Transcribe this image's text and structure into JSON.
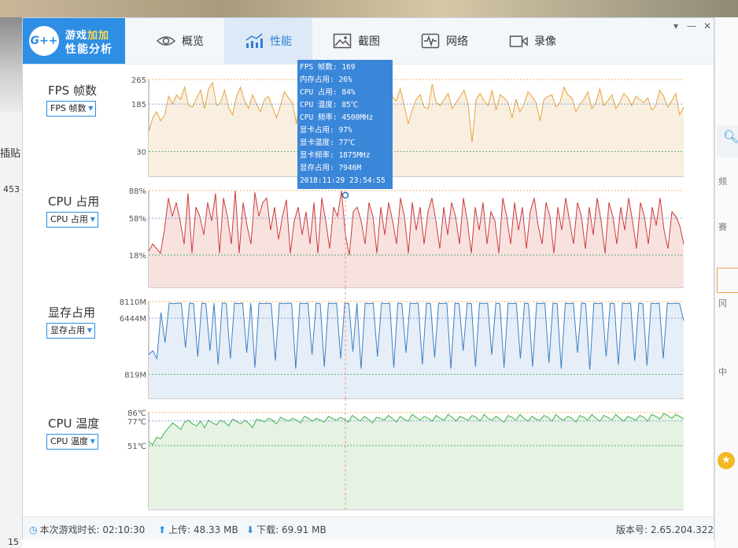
{
  "background": {
    "left_label": "插贴",
    "left_num": "453",
    "left_num2": "15",
    "right_fragments": [
      "频",
      "赛",
      "冈",
      "中"
    ]
  },
  "app": {
    "logo_mark": "G++",
    "logo_title_prefix": "游戏",
    "logo_title_highlight": "加加",
    "logo_subtitle": "性能分析",
    "accent": "#2d8ee4"
  },
  "tabs": [
    {
      "id": "overview",
      "label": "概览",
      "icon": "eye-icon"
    },
    {
      "id": "performance",
      "label": "性能",
      "icon": "performance-chart-icon",
      "active": true
    },
    {
      "id": "screenshot",
      "label": "截图",
      "icon": "image-icon"
    },
    {
      "id": "network",
      "label": "网络",
      "icon": "pulse-icon"
    },
    {
      "id": "record",
      "label": "录像",
      "icon": "video-camera-icon"
    }
  ],
  "window_controls": {
    "menu": "▾",
    "minimize": "—",
    "close": "✕"
  },
  "metrics": [
    {
      "label": "FPS 帧数",
      "select": "FPS 帧数",
      "color": "#e8a33b",
      "fill": "#f8efe0"
    },
    {
      "label": "CPU 占用",
      "select": "CPU 占用",
      "color": "#cc3a3a",
      "fill": "#f8e2e0"
    },
    {
      "label": "显存占用",
      "select": "显存占用",
      "color": "#3b7fc7",
      "fill": "#e6eef7"
    },
    {
      "label": "CPU 温度",
      "select": "CPU 温度",
      "color": "#3cb44b",
      "fill": "#e6f2e3"
    }
  ],
  "tooltip": {
    "lines": [
      "FPS 帧数: 169",
      "内存占用: 26%",
      "CPU 占用: 84%",
      "CPU 温度: 85℃",
      "CPU 频率: 4500MHz",
      "显卡占用: 97%",
      "显卡温度: 77℃",
      "显卡频率: 1875MHz",
      "显存占用: 7946M",
      "2018:11:29 23:54:55"
    ]
  },
  "chart_data": [
    {
      "type": "area",
      "title": "FPS 帧数",
      "ytick_labels": [
        "265",
        "185",
        "30"
      ],
      "y_ticks": [
        265,
        185,
        30
      ],
      "ylim": [
        0,
        265
      ],
      "values": [
        95,
        140,
        160,
        130,
        150,
        210,
        185,
        215,
        200,
        240,
        180,
        175,
        205,
        230,
        170,
        235,
        255,
        180,
        190,
        230,
        175,
        150,
        210,
        240,
        195,
        170,
        215,
        185,
        160,
        200,
        210,
        175,
        140,
        180,
        225,
        205,
        190,
        120,
        215,
        185,
        170,
        205,
        225,
        160,
        130,
        215,
        240,
        190,
        155,
        180,
        200,
        170,
        210,
        185,
        150,
        175,
        225,
        200,
        245,
        185,
        160,
        210,
        195,
        235,
        180,
        120,
        165,
        200,
        215,
        175,
        170,
        250,
        190,
        180,
        200,
        220,
        170,
        190,
        210,
        230,
        185,
        60,
        200,
        220,
        195,
        180,
        230,
        165,
        215,
        205,
        190,
        140,
        200,
        160,
        185,
        225,
        210,
        190,
        130,
        200,
        210,
        215,
        175,
        190,
        240,
        215,
        205,
        160,
        185,
        200,
        225,
        170,
        190,
        235,
        180,
        195,
        215,
        170,
        190,
        220,
        205,
        180,
        210,
        200,
        190,
        205,
        165,
        180,
        230,
        210,
        175,
        195,
        220,
        150,
        175
      ]
    },
    {
      "type": "area",
      "title": "CPU 占用",
      "ytick_labels": [
        "88%",
        "58%",
        "18%"
      ],
      "y_ticks": [
        88,
        58,
        18
      ],
      "ylim": [
        0,
        88
      ],
      "values": [
        22,
        30,
        25,
        20,
        45,
        80,
        60,
        75,
        55,
        30,
        85,
        20,
        70,
        60,
        40,
        75,
        55,
        85,
        20,
        80,
        60,
        30,
        88,
        20,
        75,
        50,
        30,
        86,
        60,
        75,
        80,
        45,
        70,
        35,
        60,
        78,
        20,
        55,
        70,
        40,
        65,
        30,
        75,
        20,
        80,
        55,
        25,
        70,
        60,
        88,
        40,
        18,
        65,
        70,
        55,
        30,
        75,
        60,
        20,
        70,
        40,
        75,
        55,
        30,
        80,
        60,
        20,
        75,
        45,
        70,
        30,
        65,
        80,
        55,
        25,
        70,
        40,
        75,
        60,
        30,
        80,
        55,
        20,
        70,
        45,
        75,
        30,
        65,
        55,
        20,
        80,
        60,
        30,
        75,
        45,
        70,
        25,
        65,
        80,
        50,
        30,
        75,
        60,
        20,
        70,
        45,
        80,
        55,
        30,
        75,
        60,
        25,
        70,
        40,
        80,
        55,
        20,
        75,
        60,
        30,
        70,
        45,
        80,
        55,
        25,
        75,
        60,
        30,
        70,
        50,
        80,
        45,
        25,
        65,
        60,
        50,
        30
      ]
    },
    {
      "type": "area",
      "title": "显存占用",
      "ytick_labels": [
        "8110M",
        "6444M",
        "819M"
      ],
      "y_ticks": [
        8110,
        6444,
        819
      ],
      "ylim": [
        0,
        8110
      ],
      "values": [
        2800,
        3200,
        2400,
        7000,
        4000,
        7950,
        7900,
        7950,
        7920,
        3500,
        7950,
        7900,
        2600,
        7950,
        7900,
        3200,
        7950,
        1800,
        7950,
        7920,
        2400,
        7950,
        7900,
        7950,
        3000,
        7950,
        1500,
        7950,
        7900,
        7950,
        7900,
        2200,
        7950,
        7900,
        7950,
        7920,
        1400,
        7950,
        7900,
        7950,
        2800,
        7950,
        7900,
        1600,
        7950,
        7900,
        7950,
        2400,
        7950,
        7900,
        3100,
        7950,
        1400,
        7950,
        7900,
        7950,
        2600,
        7950,
        7900,
        7950,
        1500,
        7950,
        7900,
        3000,
        7950,
        7900,
        7950,
        1800,
        7950,
        7900,
        2500,
        7950,
        7900,
        7950,
        1400,
        7950,
        7900,
        3200,
        7950,
        7900,
        1600,
        7950,
        7900,
        7950,
        2800,
        7950,
        7900,
        1500,
        7950,
        7900,
        7950,
        2400,
        7950,
        7900,
        1600,
        7950,
        7900,
        7950,
        2000,
        7950,
        7900,
        1400,
        7950,
        7900,
        7950,
        3000,
        7950,
        7900,
        1300,
        7950,
        7900,
        7950,
        2600,
        7950,
        7900,
        1800,
        7950,
        7900,
        7950,
        2200,
        7950,
        7900,
        1700,
        7950,
        7900,
        7950,
        2400,
        7950,
        7900,
        7950,
        7900,
        6200
      ]
    },
    {
      "type": "area",
      "title": "CPU 温度",
      "ytick_labels": [
        "86℃",
        "77℃",
        "51℃"
      ],
      "y_ticks": [
        86,
        77,
        51
      ],
      "ylim": [
        0,
        86
      ],
      "values": [
        55,
        52,
        60,
        58,
        65,
        70,
        75,
        72,
        68,
        76,
        78,
        74,
        72,
        77,
        70,
        78,
        75,
        73,
        78,
        76,
        72,
        79,
        77,
        74,
        78,
        75,
        70,
        79,
        78,
        76,
        80,
        78,
        74,
        81,
        79,
        77,
        80,
        78,
        75,
        82,
        80,
        77,
        80,
        78,
        76,
        82,
        80,
        78,
        81,
        79,
        76,
        83,
        80,
        77,
        82,
        79,
        75,
        81,
        80,
        78,
        83,
        80,
        76,
        82,
        79,
        77,
        84,
        81,
        78,
        82,
        80,
        77,
        83,
        80,
        78,
        84,
        81,
        77,
        82,
        80,
        78,
        83,
        81,
        77,
        84,
        80,
        78,
        82,
        79,
        76,
        83,
        81,
        78,
        84,
        80,
        77,
        82,
        79,
        78,
        83,
        81,
        77,
        84,
        80,
        78,
        82,
        80,
        76,
        83,
        81,
        78,
        84,
        80,
        77,
        83,
        81,
        78,
        84,
        80,
        77,
        82,
        80,
        78,
        83,
        81,
        77,
        84,
        82,
        79,
        85,
        83,
        80,
        84,
        82,
        79
      ]
    }
  ],
  "status": {
    "duration_label": "本次游戏时长:",
    "duration_value": "02:10:30",
    "upload_label": "上传:",
    "upload_value": "48.33 MB",
    "download_label": "下载:",
    "download_value": "69.91 MB",
    "version_label": "版本号:",
    "version_value": "2.65.204.322"
  }
}
